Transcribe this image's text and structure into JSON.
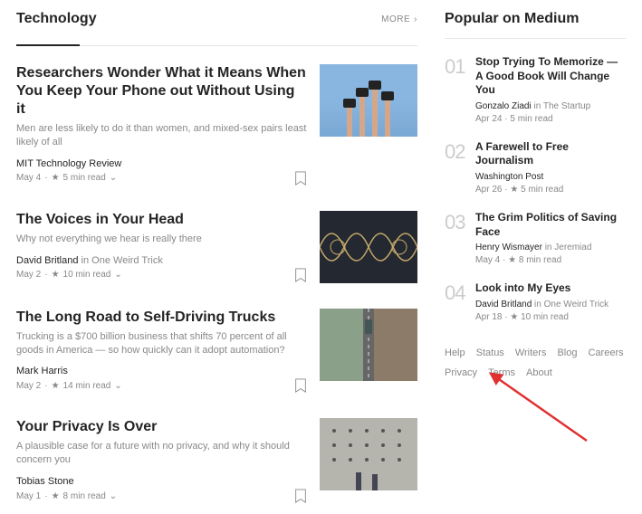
{
  "sections": {
    "main_title": "Technology",
    "more_label": "MORE",
    "sidebar_title": "Popular on Medium"
  },
  "articles": [
    {
      "title": "Researchers Wonder What it Means When You Keep Your Phone out Without Using it",
      "subtitle": "Men are less likely to do it than women, and mixed-sex pairs least likely of all",
      "author": "MIT Technology Review",
      "in_publication": "",
      "date": "May 4",
      "read": "5 min read"
    },
    {
      "title": "The Voices in Your Head",
      "subtitle": "Why not everything we hear is really there",
      "author": "David Britland",
      "in_publication": "One Weird Trick",
      "date": "May 2",
      "read": "10 min read"
    },
    {
      "title": "The Long Road to Self-Driving Trucks",
      "subtitle": "Trucking is a $700 billion business that shifts 70 percent of all goods in America — so how quickly can it adopt automation?",
      "author": "Mark Harris",
      "in_publication": "",
      "date": "May 2",
      "read": "14 min read"
    },
    {
      "title": "Your Privacy Is Over",
      "subtitle": "A plausible case for a future with no privacy, and why it should concern you",
      "author": "Tobias Stone",
      "in_publication": "",
      "date": "May 1",
      "read": "8 min read"
    }
  ],
  "popular": [
    {
      "num": "01",
      "title": "Stop Trying To Memorize — A Good Book Will Change You",
      "author": "Gonzalo Ziadi",
      "in_publication": "The Startup",
      "date": "Apr 24",
      "read": "5 min read"
    },
    {
      "num": "02",
      "title": "A Farewell to Free Journalism",
      "author": "Washington Post",
      "in_publication": "",
      "date": "Apr 26",
      "read": "5 min read"
    },
    {
      "num": "03",
      "title": "The Grim Politics of Saving Face",
      "author": "Henry Wismayer",
      "in_publication": "Jeremiad",
      "date": "May 4",
      "read": "8 min read"
    },
    {
      "num": "04",
      "title": "Look into My Eyes",
      "author": "David Britland",
      "in_publication": "One Weird Trick",
      "date": "Apr 18",
      "read": "10 min read"
    }
  ],
  "footer": [
    "Help",
    "Status",
    "Writers",
    "Blog",
    "Careers",
    "Privacy",
    "Terms",
    "About"
  ],
  "symbols": {
    "dot": "·",
    "star": "★",
    "chevron": "›",
    "down": "⌄",
    "in": "in"
  }
}
